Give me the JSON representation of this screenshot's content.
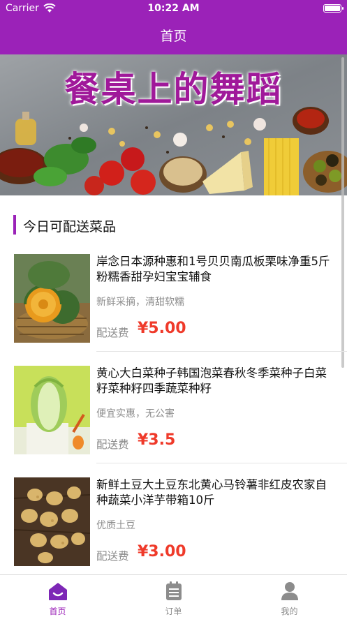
{
  "status": {
    "carrier": "Carrier",
    "time": "10:22 AM"
  },
  "nav": {
    "title": "首页"
  },
  "banner": {
    "title": "餐桌上的舞蹈"
  },
  "section": {
    "title": "今日可配送菜品"
  },
  "items": [
    {
      "title": "岸念日本源种惠和1号贝贝南瓜板栗味净重5斤粉糯香甜孕妇宝宝辅食",
      "desc": "新鲜采摘，清甜软糯",
      "fee_label": "配送费",
      "price": "¥5.00",
      "image": "pumpkin-basket"
    },
    {
      "title": "黄心大白菜种子韩国泡菜春秋冬季菜种子白菜籽菜种籽四季蔬菜种籽",
      "desc": "便宜实惠，无公害",
      "fee_label": "配送费",
      "price": "¥3.5",
      "image": "napa-cabbage"
    },
    {
      "title": "新鲜土豆大土豆东北黄心马铃薯非红皮农家自种蔬菜小洋芋带箱10斤",
      "desc": "优质土豆",
      "fee_label": "配送费",
      "price": "¥3.00",
      "image": "potatoes"
    }
  ],
  "tabs": [
    {
      "label": "首页",
      "icon": "home-icon",
      "active": true
    },
    {
      "label": "订单",
      "icon": "order-list-icon",
      "active": false
    },
    {
      "label": "我的",
      "icon": "profile-icon",
      "active": false
    }
  ],
  "colors": {
    "brand": "#9b22b8",
    "price": "#ef3a2a",
    "muted": "#8c8c8c"
  }
}
